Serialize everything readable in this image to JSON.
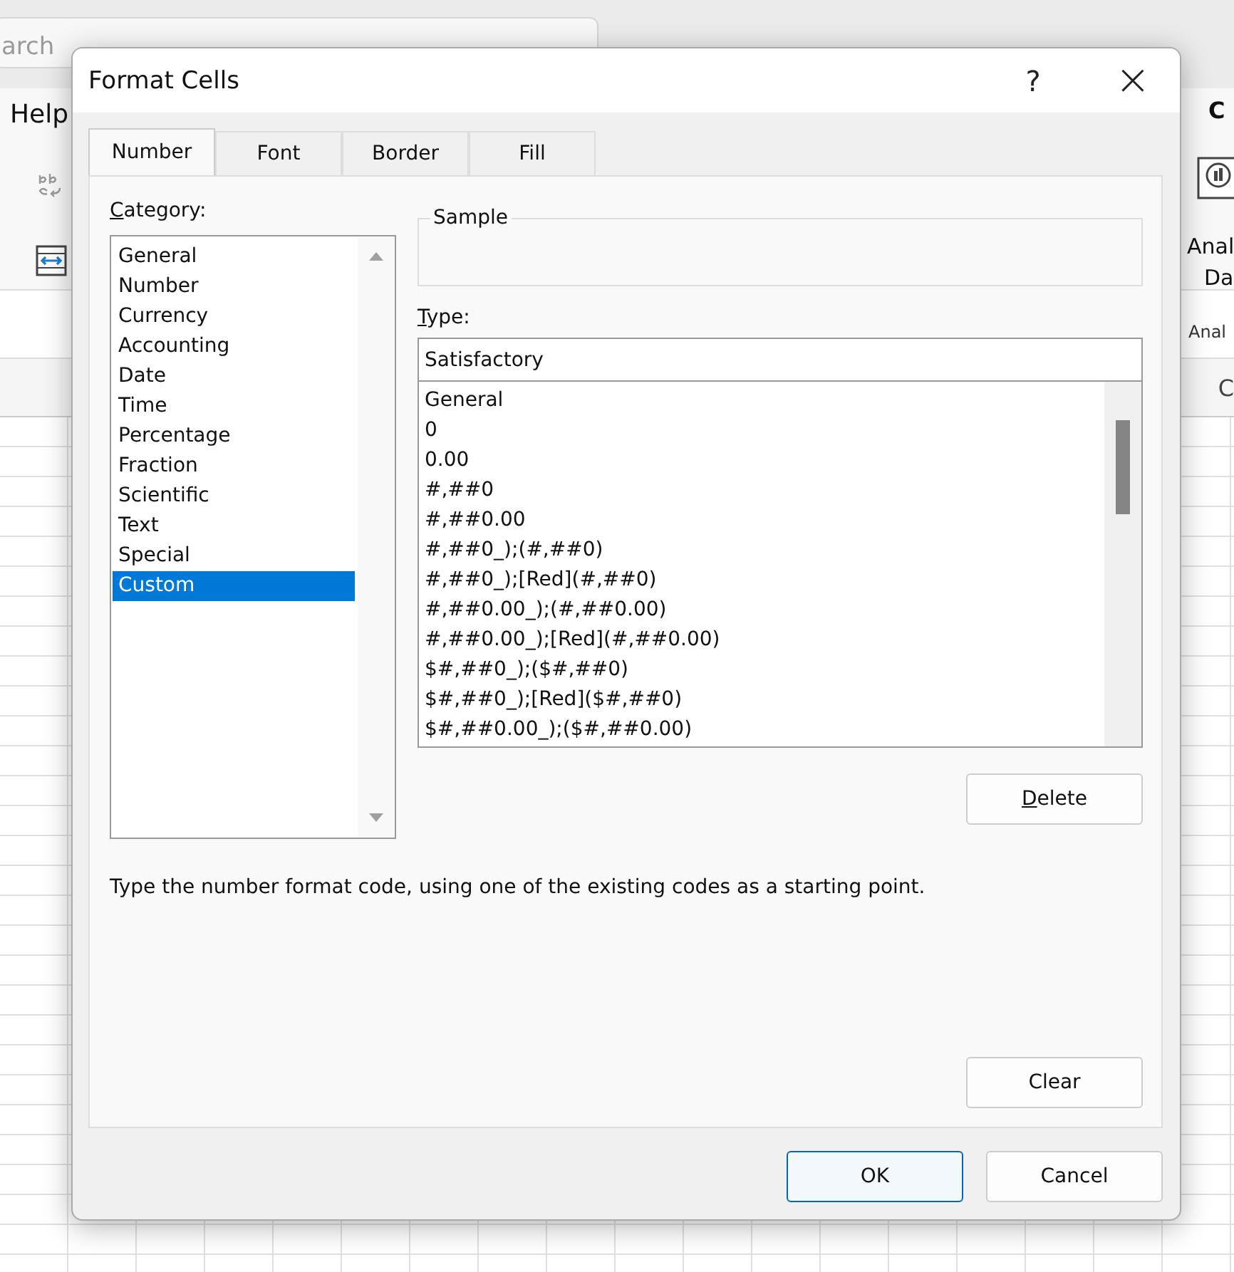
{
  "background": {
    "search_text": "arch",
    "ribbon_tab": "Help",
    "comments_label": "C",
    "analyze_label_1": "Anal",
    "analyze_label_2": "Da",
    "group_label": "Anal",
    "column_right": "C"
  },
  "window": {
    "title": "Format Cells",
    "help": "?",
    "close": "×"
  },
  "tabs": [
    {
      "label": "Number",
      "selected": true
    },
    {
      "label": "Font",
      "selected": false
    },
    {
      "label": "Border",
      "selected": false
    },
    {
      "label": "Fill",
      "selected": false
    }
  ],
  "category": {
    "label": "Category:",
    "items": [
      {
        "label": "General",
        "selected": false
      },
      {
        "label": "Number",
        "selected": false
      },
      {
        "label": "Currency",
        "selected": false
      },
      {
        "label": "Accounting",
        "selected": false
      },
      {
        "label": "Date",
        "selected": false
      },
      {
        "label": "Time",
        "selected": false
      },
      {
        "label": "Percentage",
        "selected": false
      },
      {
        "label": "Fraction",
        "selected": false
      },
      {
        "label": "Scientific",
        "selected": false
      },
      {
        "label": "Text",
        "selected": false
      },
      {
        "label": "Special",
        "selected": false
      },
      {
        "label": "Custom",
        "selected": true
      }
    ]
  },
  "sample": {
    "label": "Sample"
  },
  "type": {
    "label": "Type:",
    "value": "Satisfactory",
    "formats": [
      "General",
      "0",
      "0.00",
      "#,##0",
      "#,##0.00",
      "#,##0_);(#,##0)",
      "#,##0_);[Red](#,##0)",
      "#,##0.00_);(#,##0.00)",
      "#,##0.00_);[Red](#,##0.00)",
      "$#,##0_);($#,##0)",
      "$#,##0_);[Red]($#,##0)",
      "$#,##0.00_);($#,##0.00)"
    ]
  },
  "delete_button": "Delete",
  "description": "Type the number format code, using one of the existing codes as a starting point.",
  "clear_button": "Clear",
  "buttons": [
    {
      "label": "OK",
      "kind": "default"
    },
    {
      "label": "Cancel",
      "kind": "normal"
    }
  ]
}
